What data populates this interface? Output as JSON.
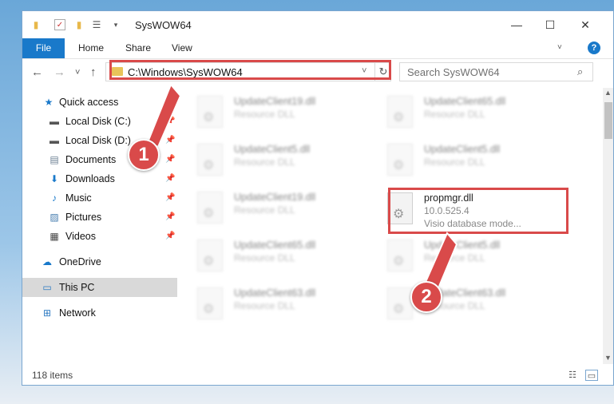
{
  "window": {
    "title": "SysWOW64",
    "controls": {
      "minimize": "—",
      "maximize": "☐",
      "close": "✕"
    }
  },
  "ribbon": {
    "tabs": [
      "File",
      "Home",
      "Share",
      "View"
    ],
    "expand_icon": "˅",
    "help_icon": "?"
  },
  "nav": {
    "back": "←",
    "forward": "→",
    "recent": "˅",
    "up": "↑"
  },
  "address": {
    "path": "C:\\Windows\\SysWOW64",
    "dropdown_icon": "˅",
    "refresh_icon": "↻"
  },
  "search": {
    "placeholder": "Search SysWOW64",
    "icon": "⌕"
  },
  "sidebar": {
    "items": [
      {
        "label": "Quick access",
        "icon": "★",
        "icon_color": "#1979ca",
        "pinned": false
      },
      {
        "label": "Local Disk (C:)",
        "icon": "▬",
        "icon_color": "#555555",
        "pinned": true
      },
      {
        "label": "Local Disk (D:)",
        "icon": "▬",
        "icon_color": "#555555",
        "pinned": true
      },
      {
        "label": "Documents",
        "icon": "▤",
        "icon_color": "#6b7f93",
        "pinned": true
      },
      {
        "label": "Downloads",
        "icon": "⬇",
        "icon_color": "#1979ca",
        "pinned": true
      },
      {
        "label": "Music",
        "icon": "♪",
        "icon_color": "#1979ca",
        "pinned": true
      },
      {
        "label": "Pictures",
        "icon": "▨",
        "icon_color": "#4a7fb0",
        "pinned": true
      },
      {
        "label": "Videos",
        "icon": "▦",
        "icon_color": "#444444",
        "pinned": true
      },
      {
        "label": "OneDrive",
        "icon": "☁",
        "icon_color": "#1979ca",
        "pinned": false
      },
      {
        "label": "This PC",
        "icon": "▭",
        "icon_color": "#2b79c2",
        "pinned": false
      },
      {
        "label": "Network",
        "icon": "⊞",
        "icon_color": "#2b79c2",
        "pinned": false
      }
    ],
    "pin_icon": "📌"
  },
  "files": {
    "left": [
      {
        "name": "UpdateClient19.dll",
        "type": "Resource DLL"
      },
      {
        "name": "UpdateClient5.dll",
        "type": "Resource DLL"
      },
      {
        "name": "UpdateClient19.dll",
        "type": "Resource DLL"
      },
      {
        "name": "UpdateClient65.dll",
        "type": "Resource DLL"
      },
      {
        "name": "UpdateClient63.dll",
        "type": "Resource DLL"
      }
    ],
    "right": [
      {
        "name": "UpdateClient65.dll",
        "type": "Resource DLL"
      },
      {
        "name": "UpdateClient5.dll",
        "type": "Resource DLL"
      },
      {
        "name": "propmgr.dll",
        "version": "10.0.525.4",
        "description": "Visio database mode..."
      },
      {
        "name": "UpdateClient5.dll",
        "type": "Resource DLL"
      },
      {
        "name": "UpdateClient63.dll",
        "type": "Resource DLL"
      }
    ]
  },
  "status": {
    "items_count": "118 items",
    "details_view_icon": "☷",
    "large_icons_view_icon": "▭"
  },
  "callouts": [
    "1",
    "2"
  ],
  "colors": {
    "accent": "#1979ca",
    "highlight": "#d94a4a"
  }
}
